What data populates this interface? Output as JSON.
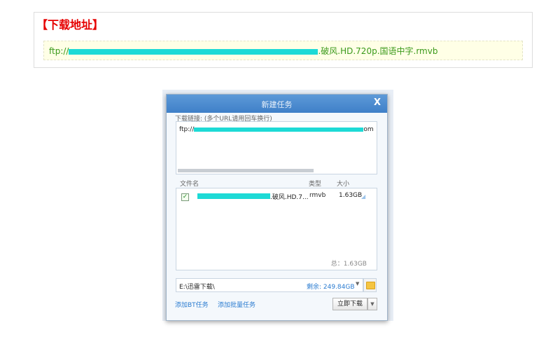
{
  "article": {
    "heading": "【下载地址】",
    "link_prefix": "ftp://",
    "link_suffix": ".破风.HD.720p.国语中字.rmvb"
  },
  "dialog": {
    "title": "新建任务",
    "close": "X",
    "url_label": "下载链接: (多个URL请用回车换行)",
    "url_prefix": "ftp://",
    "url_suffix": "om",
    "columns": {
      "name": "文件名",
      "type": "类型",
      "size": "大小"
    },
    "files": [
      {
        "name_suffix": ".破风.HD.7...",
        "type": "rmvb",
        "size": "1.63GB",
        "checked": true
      }
    ],
    "total": "总：1.63GB",
    "path": "E:\\迅雷下载\\",
    "free_space": "剩余: 249.84GB",
    "add_bt": "添加BT任务",
    "add_batch": "添加批量任务",
    "download_now": "立即下载"
  },
  "colors": {
    "heading": "#e60000",
    "link": "#3b9a1b",
    "redaction": "#1ddad6",
    "title_bar": "#4a8bd0"
  }
}
